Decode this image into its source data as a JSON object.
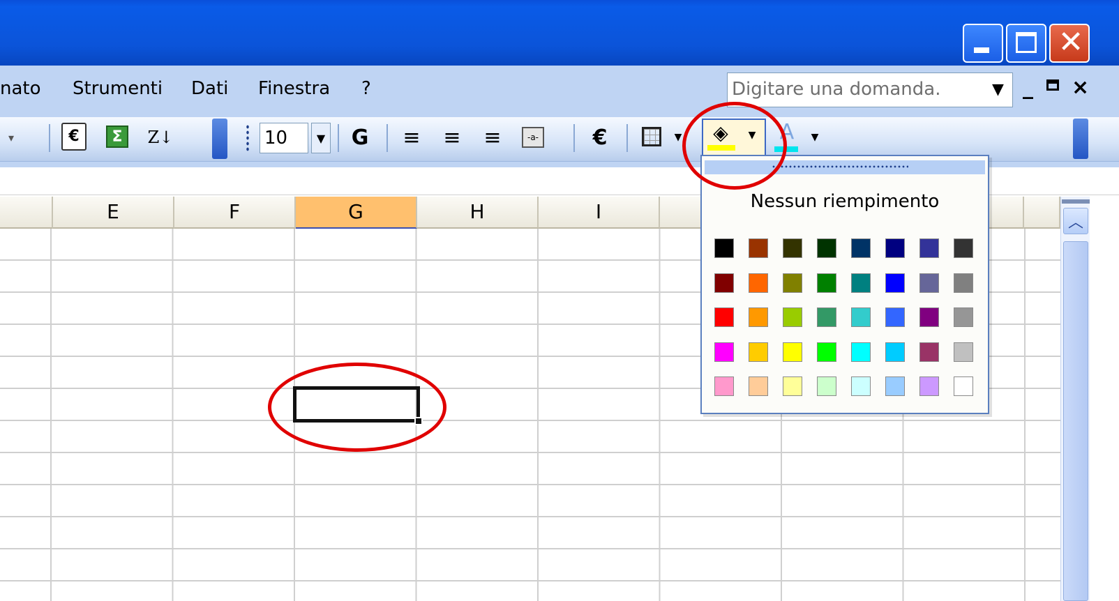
{
  "window": {
    "controls": {
      "minimize": "minimize",
      "maximize": "maximize",
      "close": "close"
    }
  },
  "menubar": {
    "items": [
      "nato",
      "Strumenti",
      "Dati",
      "Finestra",
      "?"
    ],
    "ask_placeholder": "Digitare una domanda.",
    "mdi_min": "_",
    "mdi_restore": "🗗",
    "mdi_close": "×"
  },
  "toolbar": {
    "font_size": "10",
    "bold_label": "G",
    "euro_label": "€",
    "sort_label": "Z↓"
  },
  "columns": {
    "headers": [
      "",
      "E",
      "F",
      "G",
      "H",
      "I",
      "",
      "",
      "",
      ""
    ],
    "selected": "G"
  },
  "fill_popup": {
    "no_fill_label": "Nessun riempimento",
    "colors": [
      [
        "#000000",
        "#993300",
        "#333300",
        "#003300",
        "#003366",
        "#000080",
        "#333399",
        "#333333"
      ],
      [
        "#800000",
        "#FF6600",
        "#808000",
        "#008000",
        "#008080",
        "#0000FF",
        "#666699",
        "#808080"
      ],
      [
        "#FF0000",
        "#FF9900",
        "#99CC00",
        "#339966",
        "#33CCCC",
        "#3366FF",
        "#800080",
        "#969696"
      ],
      [
        "#FF00FF",
        "#FFCC00",
        "#FFFF00",
        "#00FF00",
        "#00FFFF",
        "#00CCFF",
        "#993366",
        "#C0C0C0"
      ],
      [
        "#FF99CC",
        "#FFCC99",
        "#FFFF99",
        "#CCFFCC",
        "#CCFFFF",
        "#99CCFF",
        "#CC99FF",
        "#FFFFFF"
      ]
    ]
  },
  "annotation_color": "#E00000"
}
